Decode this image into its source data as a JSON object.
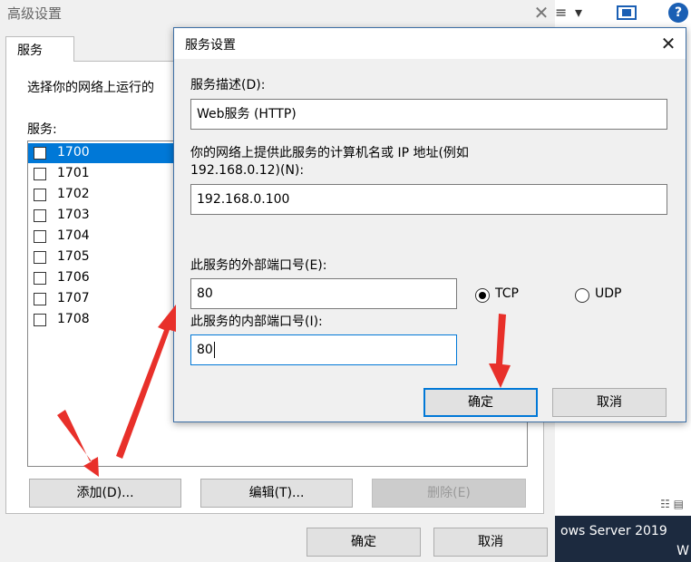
{
  "background_app": {
    "brand_line1": "ows Server 2019",
    "brand_line2": "W",
    "toolbar_glyph_1": "≡",
    "toolbar_glyph_2": "▾",
    "help": "?",
    "status_icons": "☷ ▤"
  },
  "main_dialog": {
    "title": "高级设置",
    "close": "✕",
    "tab_label": "服务",
    "description": "选择你的网络上运行的",
    "services_label": "服务:",
    "services": [
      {
        "name": "1700",
        "selected": true
      },
      {
        "name": "1701",
        "selected": false
      },
      {
        "name": "1702",
        "selected": false
      },
      {
        "name": "1703",
        "selected": false
      },
      {
        "name": "1704",
        "selected": false
      },
      {
        "name": "1705",
        "selected": false
      },
      {
        "name": "1706",
        "selected": false
      },
      {
        "name": "1707",
        "selected": false
      },
      {
        "name": "1708",
        "selected": false
      }
    ],
    "add_button": "添加(D)...",
    "edit_button": "编辑(T)...",
    "delete_button": "删除(E)",
    "ok_button": "确定",
    "cancel_button": "取消"
  },
  "service_dialog": {
    "title": "服务设置",
    "close": "✕",
    "desc_label": "服务描述(D):",
    "desc_value": "Web服务 (HTTP)",
    "host_label_1": "你的网络上提供此服务的计算机名或 IP 地址(例如",
    "host_label_2": "192.168.0.12)(N):",
    "host_value": "192.168.0.100",
    "ext_port_label": "此服务的外部端口号(E):",
    "ext_port_value": "80",
    "int_port_label": "此服务的内部端口号(I):",
    "int_port_value": "80",
    "protocol_options": [
      "TCP",
      "UDP"
    ],
    "protocol_selected": "TCP",
    "ok_button": "确定",
    "cancel_button": "取消"
  },
  "colors": {
    "accent": "#0078d7",
    "annotation_arrow": "#e8302a",
    "brand_bar": "#1c2a3f"
  }
}
